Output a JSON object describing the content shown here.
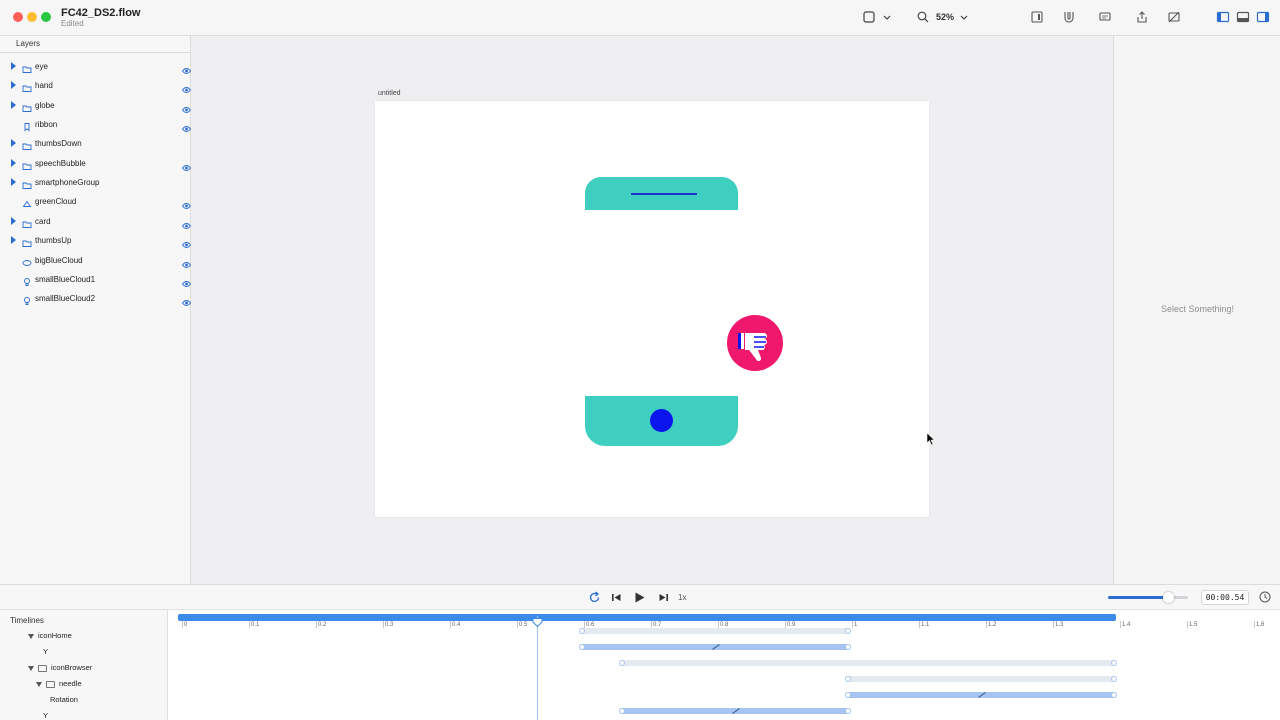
{
  "window": {
    "title": "FC42_DS2.flow",
    "subtitle": "Edited"
  },
  "toolbar": {
    "zoom": "52%"
  },
  "layers": {
    "header": "Layers",
    "items": [
      {
        "name": "eye",
        "icon": "folder-icon",
        "expandable": true,
        "visible": true
      },
      {
        "name": "hand",
        "icon": "folder-icon",
        "expandable": true,
        "visible": true
      },
      {
        "name": "globe",
        "icon": "folder-icon",
        "expandable": true,
        "visible": true
      },
      {
        "name": "ribbon",
        "icon": "bookmark-icon",
        "expandable": false,
        "visible": true
      },
      {
        "name": "thumbsDown",
        "icon": "folder-icon",
        "expandable": true,
        "visible": false
      },
      {
        "name": "speechBubble",
        "icon": "folder-icon",
        "expandable": true,
        "visible": true
      },
      {
        "name": "smartphoneGroup",
        "icon": "folder-icon",
        "expandable": true,
        "visible": false
      },
      {
        "name": "greenCloud",
        "icon": "cloud-icon",
        "expandable": false,
        "visible": true
      },
      {
        "name": "card",
        "icon": "folder-icon",
        "expandable": true,
        "visible": true
      },
      {
        "name": "thumbsUp",
        "icon": "folder-icon",
        "expandable": true,
        "visible": true
      },
      {
        "name": "bigBlueCloud",
        "icon": "ellipse-icon",
        "expandable": false,
        "visible": true
      },
      {
        "name": "smallBlueCloud1",
        "icon": "bulb-icon",
        "expandable": false,
        "visible": true
      },
      {
        "name": "smallBlueCloud2",
        "icon": "bulb-icon",
        "expandable": false,
        "visible": true
      }
    ]
  },
  "canvas": {
    "artboard_label": "untitled",
    "colors": {
      "teal": "#3ecfc0",
      "blue": "#0b16ef",
      "pink": "#f0186c",
      "white": "#ffffff"
    }
  },
  "inspector": {
    "message": "Select Something!"
  },
  "playback": {
    "speed": "1x",
    "time": "00:00.54",
    "volume": 0.75
  },
  "timelines": {
    "header": "Timelines",
    "ruler_ticks": [
      "0",
      "0.1",
      "0.2",
      "0.3",
      "0.4",
      "0.5",
      "0.6",
      "0.7",
      "0.8",
      "0.9",
      "1",
      "1.1",
      "1.2",
      "1.3",
      "1.4",
      "1.5",
      "1.6"
    ],
    "rows": [
      {
        "label": "iconHome",
        "kind": "group-open",
        "level": 1
      },
      {
        "label": "Y",
        "kind": "property",
        "level": 2
      },
      {
        "label": "iconBrowser",
        "kind": "group-open-folder",
        "level": 1
      },
      {
        "label": "needle",
        "kind": "group-open-folder",
        "level": 2
      },
      {
        "label": "Rotation",
        "kind": "property",
        "level": 3
      },
      {
        "label": "Y",
        "kind": "property",
        "level": 2
      }
    ]
  }
}
